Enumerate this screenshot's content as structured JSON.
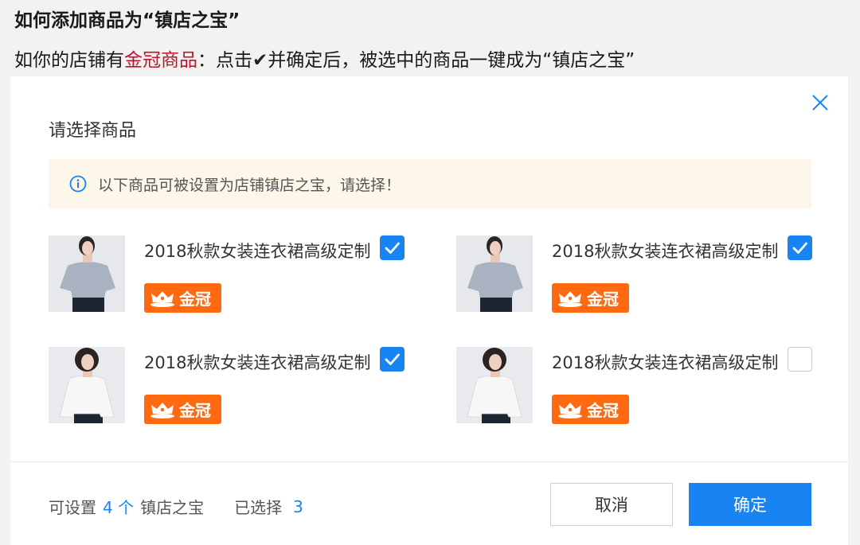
{
  "intro": {
    "title": "如何添加商品为“镇店之宝”",
    "line_before": "如你的店铺有",
    "line_highlight": "金冠商品",
    "line_mid": "：点击",
    "line_check": "✔",
    "line_after": "并确定后，被选中的商品一键成为“镇店之宝”"
  },
  "dialog": {
    "title": "请选择商品",
    "notice": "以下商品可被设置为店铺镇店之宝，请选择！",
    "items": [
      {
        "title": "2018秋款女装连衣裙高级定制",
        "badge": "金冠",
        "checked": true
      },
      {
        "title": "2018秋款女装连衣裙高级定制",
        "badge": "金冠",
        "checked": true
      },
      {
        "title": "2018秋款女装连衣裙高级定制",
        "badge": "金冠",
        "checked": true
      },
      {
        "title": "2018秋款女装连衣裙高级定制",
        "badge": "金冠",
        "checked": false
      }
    ],
    "footer": {
      "can_set_label": "可设置",
      "can_set_count": "4 个",
      "can_set_suffix": "镇店之宝",
      "selected_label": "已选择",
      "selected_count": "3"
    },
    "cancel_label": "取消",
    "confirm_label": "确定"
  },
  "colors": {
    "accent": "#1784f2",
    "badge": "#ff6a10",
    "highlight": "#c0132c",
    "notice_bg": "#fdf7e9"
  }
}
